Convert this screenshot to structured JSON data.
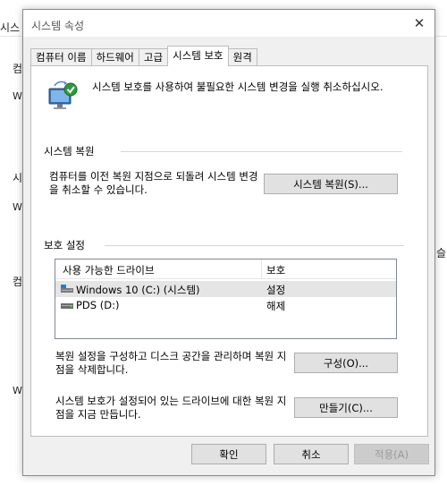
{
  "background": {
    "title_fragment": "시스",
    "fragments": [
      "컴",
      "W",
      "시",
      "W",
      "컴",
      "W",
      "슬"
    ],
    "right_fragment": "슬"
  },
  "dialog": {
    "title": "시스템 속성",
    "close_glyph": "✕",
    "tabs": [
      "컴퓨터 이름",
      "하드웨어",
      "고급",
      "시스템 보호",
      "원격"
    ],
    "active_tab_index": 3,
    "intro_text": "시스템 보호를 사용하여 불필요한 시스템 변경을 실행 취소하십시오.",
    "restore": {
      "group_label": "시스템 복원",
      "description": "컴퓨터를 이전 복원 지점으로 되돌려 시스템 변경을 취소할 수 있습니다.",
      "button_label": "시스템 복원(S)..."
    },
    "protection": {
      "group_label": "보호 설정",
      "columns": [
        "사용 가능한 드라이브",
        "보호"
      ],
      "drives": [
        {
          "name": "Windows 10 (C:) (시스템)",
          "protection": "설정",
          "icon": "system-drive-icon",
          "selected": true
        },
        {
          "name": "PDS (D:)",
          "protection": "해제",
          "icon": "drive-icon",
          "selected": false
        }
      ],
      "configure_text": "복원 설정을 구성하고 디스크 공간을 관리하며 복원 지점을 삭제합니다.",
      "configure_button": "구성(O)...",
      "create_text": "시스템 보호가 설정되어 있는 드라이브에 대한 복원 지점을 지금 만듭니다.",
      "create_button": "만들기(C)..."
    },
    "footer": {
      "ok": "확인",
      "cancel": "취소",
      "apply": "적용(A)"
    }
  },
  "colors": {
    "dialog_bg": "#f0f0f0",
    "panel_bg": "#ffffff",
    "button_bg": "#e1e1e1",
    "selected_row": "#e5e5e5"
  }
}
